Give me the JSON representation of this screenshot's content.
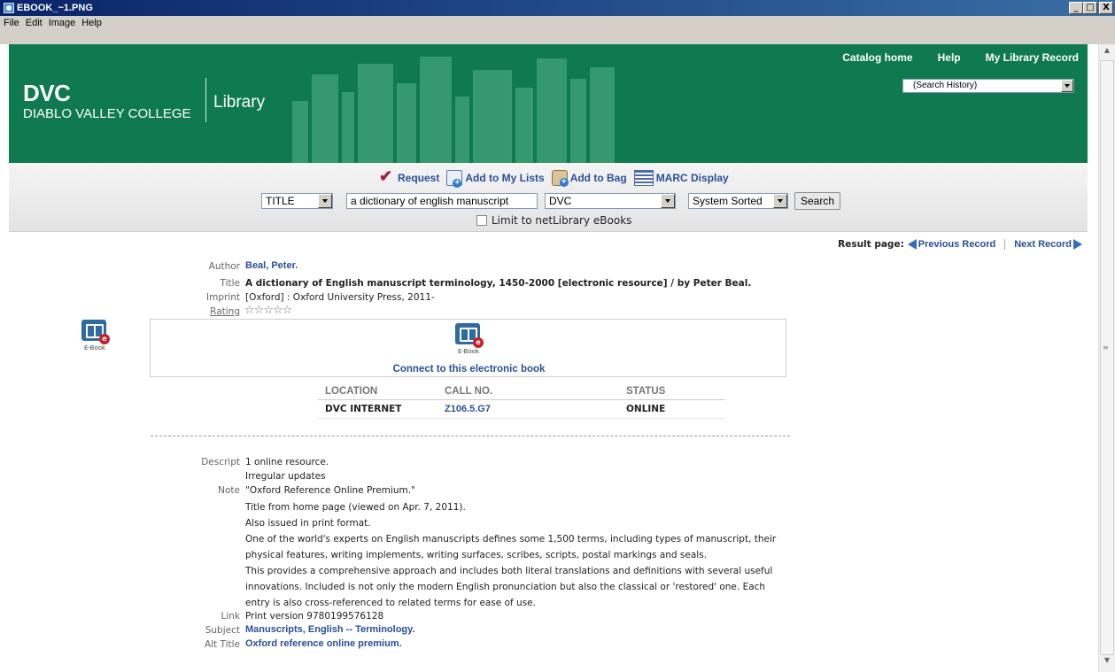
{
  "window": {
    "title": "EBOOK_~1.PNG",
    "menu": [
      "File",
      "Edit",
      "Image",
      "Help"
    ],
    "buttons": {
      "minimize": "_",
      "maximize": "□",
      "close": "X"
    }
  },
  "header": {
    "logo_short": "DVC",
    "logo_name": "DIABLO VALLEY COLLEGE",
    "logo_library": "Library",
    "links": [
      "Catalog home",
      "Help",
      "My Library Record"
    ],
    "search_history": "(Search History)",
    "brand_color": "#0f7a4f"
  },
  "toolbar": {
    "actions": [
      "Request",
      "Add to My Lists",
      "Add to Bag",
      "MARC Display"
    ],
    "search_type": "TITLE",
    "search_value": "a dictionary of english manuscript",
    "scope": "DVC",
    "sort": "System Sorted",
    "search_label": "Search",
    "limit_label": "Limit to netLibrary eBooks"
  },
  "nav": {
    "result_page": "Result page:",
    "previous": "Previous Record",
    "next": "Next Record"
  },
  "record": {
    "author_label": "Author",
    "author": "Beal, Peter.",
    "title_label": "Title",
    "title": "A dictionary of English manuscript terminology, 1450-2000 [electronic resource] / by Peter Beal.",
    "imprint_label": "Imprint",
    "imprint": "[Oxford] : Oxford University Press, 2011-",
    "rating_label": "Rating",
    "rating": "☆☆☆☆☆",
    "ebook_label": "E-Book",
    "connect": "Connect to this electronic book"
  },
  "holdings": {
    "headers": [
      "LOCATION",
      "CALL NO.",
      "STATUS"
    ],
    "rows": [
      [
        "DVC INTERNET",
        "Z106.5.G7",
        "ONLINE"
      ]
    ]
  },
  "details": {
    "descript_label": "Descript",
    "descript": [
      "1 online resource.",
      "Irregular updates"
    ],
    "note_label": "Note",
    "note": [
      "\"Oxford Reference Online Premium.\"",
      "Title from home page (viewed on Apr. 7, 2011).",
      "Also issued in print format.",
      "One of the world's experts on English manuscripts defines some 1,500 terms, including types of manuscript, their",
      "physical features, writing implements, writing surfaces, scribes, scripts, postal markings and seals.",
      "This provides a comprehensive approach and includes both literal translations and definitions with several useful",
      "innovations. Included is not only the modern English pronunciation but also the classical or 'restored' one. Each",
      "entry is also cross-referenced to related terms for ease of use."
    ],
    "link_label": "Link",
    "link": "Print version 9780199576128",
    "subject_label": "Subject",
    "subject": "Manuscripts, English -- Terminology.",
    "alt_title_label": "Alt Title",
    "alt_title": "Oxford reference online premium."
  }
}
